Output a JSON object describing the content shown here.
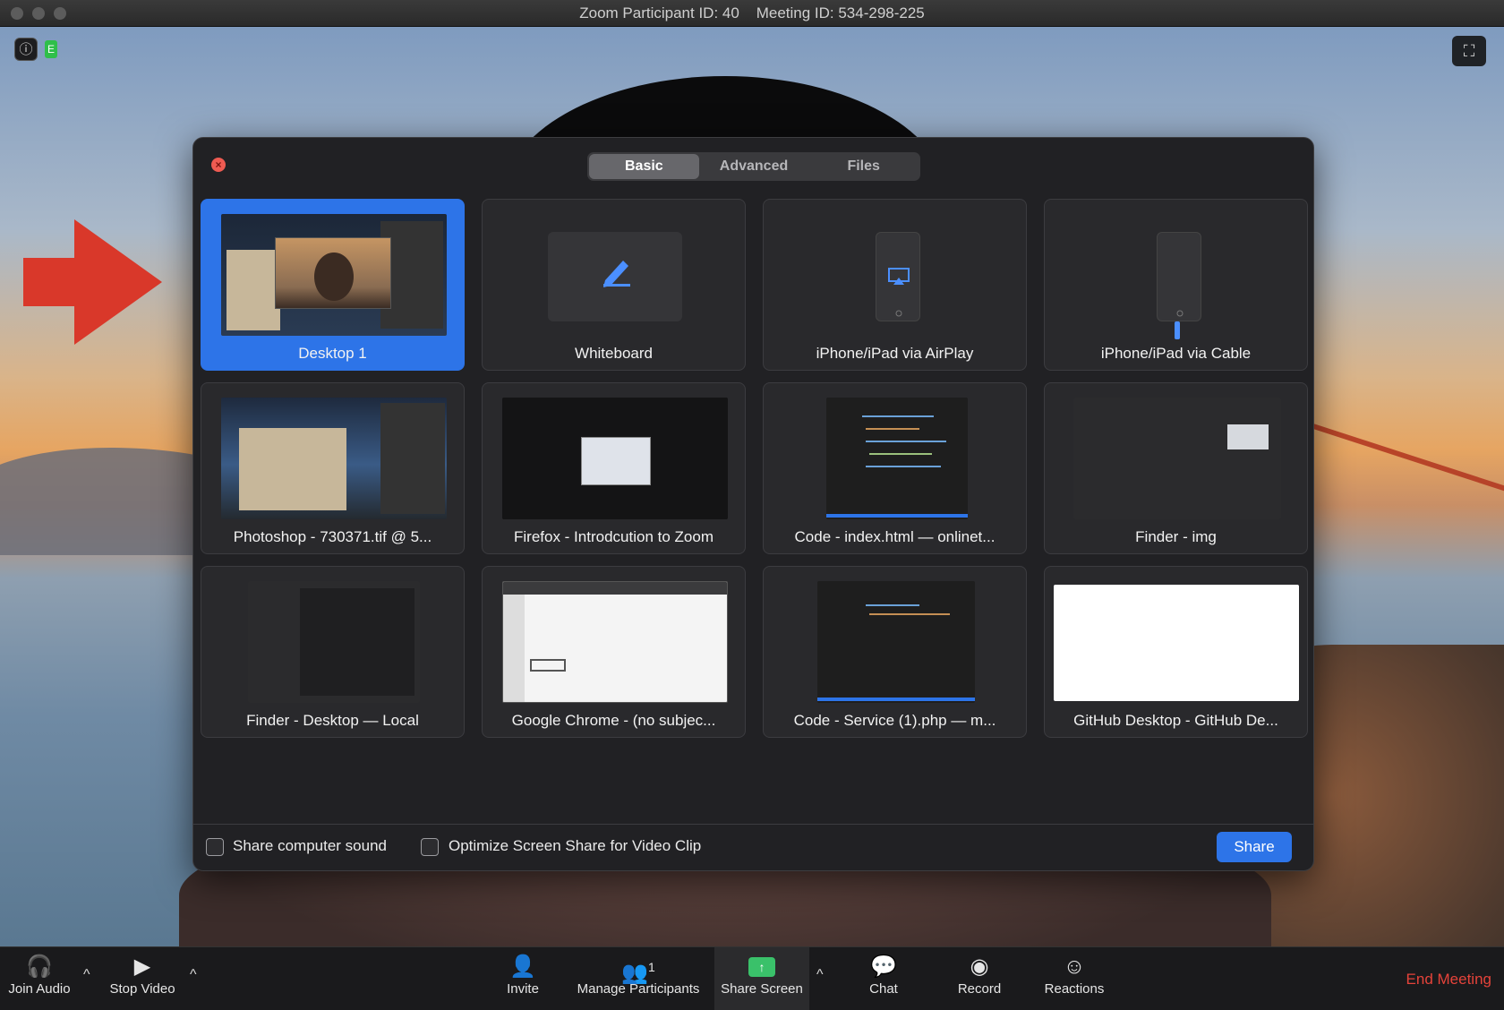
{
  "window": {
    "title": "Zoom Participant ID: 40    Meeting ID: 534-298-225"
  },
  "top_icons": {
    "info": "ⓘ",
    "encryption": "E",
    "fullscreen": "⛶"
  },
  "dialog": {
    "close_glyph": "×",
    "tabs": [
      {
        "label": "Basic",
        "active": true
      },
      {
        "label": "Advanced",
        "active": false
      },
      {
        "label": "Files",
        "active": false
      }
    ],
    "tiles": [
      {
        "label": "Desktop 1",
        "selected": true
      },
      {
        "label": "Whiteboard"
      },
      {
        "label": "iPhone/iPad via AirPlay"
      },
      {
        "label": "iPhone/iPad via Cable"
      },
      {
        "label": "Photoshop - 730371.tif @ 5..."
      },
      {
        "label": "Firefox - Introdcution to Zoom"
      },
      {
        "label": "Code - index.html — onlinet..."
      },
      {
        "label": "Finder - img"
      },
      {
        "label": "Finder - Desktop — Local"
      },
      {
        "label": "Google Chrome - (no subjec..."
      },
      {
        "label": "Code - Service (1).php — m..."
      },
      {
        "label": "GitHub Desktop - GitHub De..."
      }
    ],
    "share_computer_sound": "Share computer sound",
    "optimize_video_clip": "Optimize Screen Share for Video Clip",
    "share_button": "Share"
  },
  "toolbar": {
    "join_audio": "Join Audio",
    "stop_video": "Stop Video",
    "invite": "Invite",
    "manage_participants": "Manage Participants",
    "participant_count": "1",
    "share_screen": "Share Screen",
    "chat": "Chat",
    "record": "Record",
    "reactions": "Reactions",
    "end_meeting": "End Meeting",
    "caret": "^"
  },
  "colors": {
    "accent_blue": "#2d74e8",
    "share_green": "#3ac16a",
    "end_red": "#e5433a",
    "arrow_red": "#d9382a"
  }
}
